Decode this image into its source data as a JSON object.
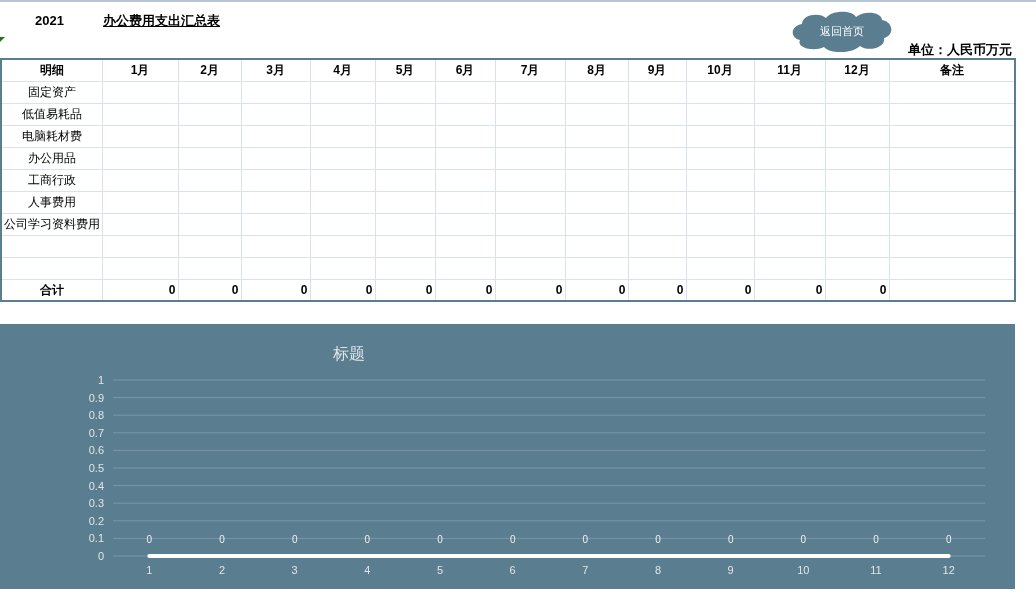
{
  "header": {
    "year": "2021",
    "title": "办公费用支出汇总表",
    "home_button": "返回首页",
    "unit": "单位：人民币万元"
  },
  "table": {
    "columns": [
      "明细",
      "1月",
      "2月",
      "3月",
      "4月",
      "5月",
      "6月",
      "7月",
      "8月",
      "9月",
      "10月",
      "11月",
      "12月",
      "备注"
    ],
    "rows": [
      {
        "kind": "item",
        "label": "固定资产"
      },
      {
        "kind": "item",
        "label": "低值易耗品"
      },
      {
        "kind": "item",
        "label": "电脑耗材费"
      },
      {
        "kind": "item",
        "label": "办公用品"
      },
      {
        "kind": "item",
        "label": "工商行政"
      },
      {
        "kind": "item",
        "label": "人事费用"
      },
      {
        "kind": "item",
        "label": "公司学习资料费用"
      },
      {
        "kind": "blank"
      },
      {
        "kind": "blank"
      },
      {
        "kind": "total",
        "label": "合计",
        "values": [
          "0",
          "0",
          "0",
          "0",
          "0",
          "0",
          "0",
          "0",
          "0",
          "0",
          "0",
          "0"
        ]
      }
    ]
  },
  "chart": {
    "chart_data": {
      "type": "line",
      "title": "标题",
      "categories": [
        "1",
        "2",
        "3",
        "4",
        "5",
        "6",
        "7",
        "8",
        "9",
        "10",
        "11",
        "12"
      ],
      "series": [
        {
          "color": "#ffffff",
          "values": [
            0,
            0,
            0,
            0,
            0,
            0,
            0,
            0,
            0,
            0,
            0,
            0
          ]
        }
      ],
      "ylim": [
        0,
        1
      ],
      "yticks": [
        0,
        0.1,
        0.2,
        0.3,
        0.4,
        0.5,
        0.6,
        0.7,
        0.8,
        0.9,
        1
      ],
      "data_labels": true,
      "grid": true
    }
  }
}
